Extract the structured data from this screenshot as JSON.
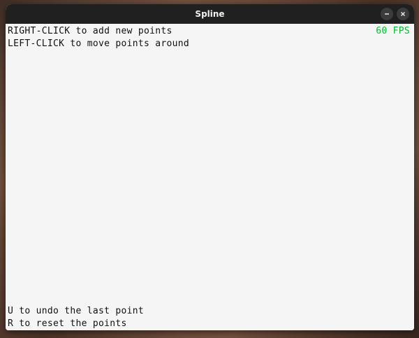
{
  "window": {
    "title": "Spline",
    "minimize_icon": "minimize-icon",
    "close_icon": "close-icon"
  },
  "canvas": {
    "instructions_top": [
      "RIGHT-CLICK to add new points",
      "LEFT-CLICK to move points around"
    ],
    "instructions_bottom": [
      "U to undo the last point",
      "R to reset the points"
    ],
    "fps_text": "60 FPS",
    "fps_color": "#00c030",
    "background_color": "#f5f5f5"
  }
}
